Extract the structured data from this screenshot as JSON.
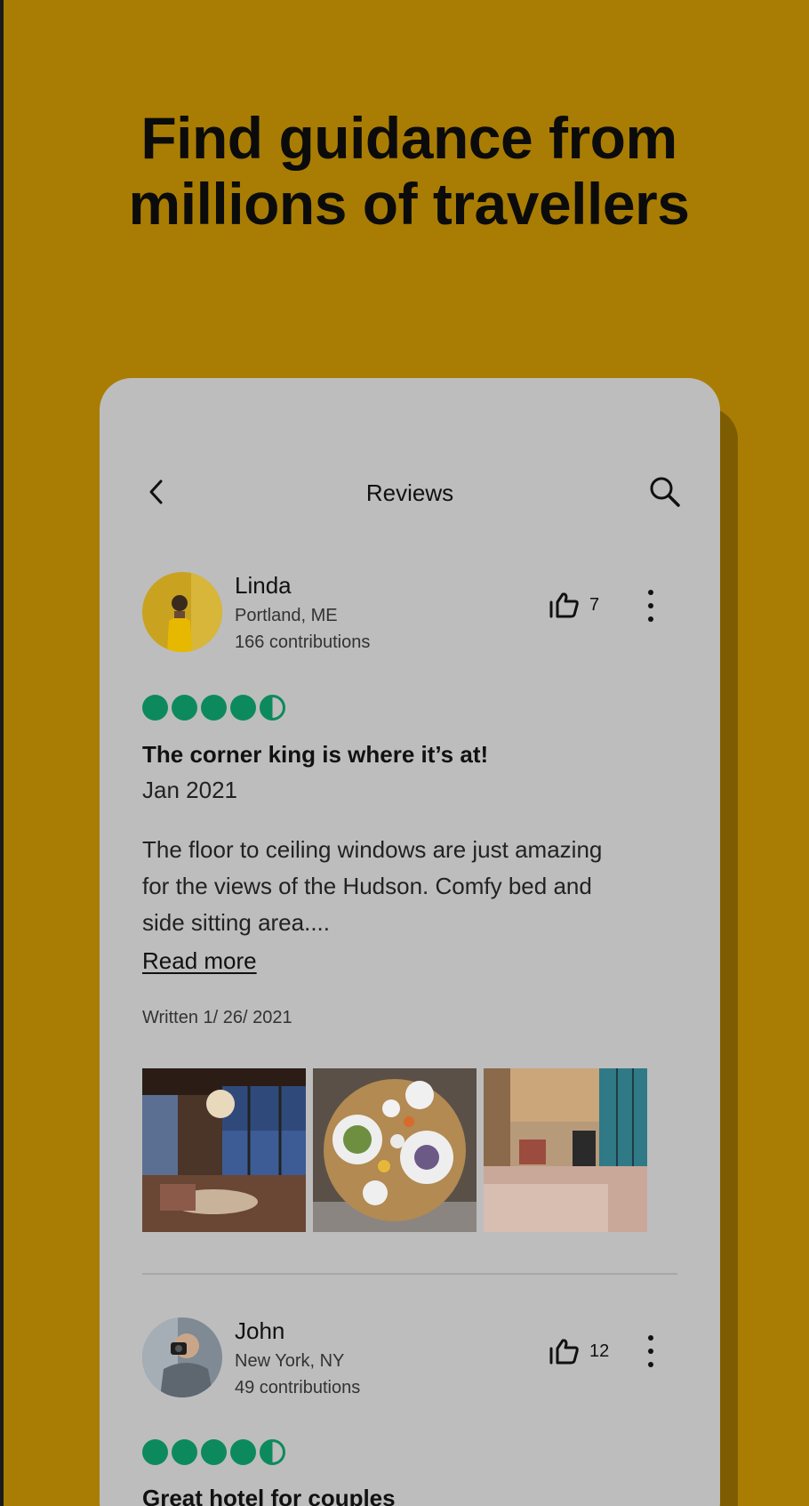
{
  "headline": {
    "line1": "Find guidance from",
    "line2": "millions of travellers"
  },
  "colors": {
    "background": "#A97D03",
    "card": "#BDBDBD",
    "rating_green": "#0C8A5D"
  },
  "topbar": {
    "back_icon": "chevron-left-icon",
    "title": "Reviews",
    "search_icon": "search-icon"
  },
  "reviews": [
    {
      "name": "Linda",
      "location": "Portland, ME",
      "contributions": "166 contributions",
      "likes": "7",
      "rating": 4.5,
      "title": "The corner king is where it’s at!",
      "date": "Jan 2021",
      "body_line1": "The floor to ceiling windows are just amazing",
      "body_line2": "for the views of the Hudson. Comfy bed and",
      "body_line3": "side sitting area....",
      "read_more": "Read more",
      "written": "Written 1/ 26/ 2021"
    },
    {
      "name": "John",
      "location": "New York, NY",
      "contributions": "49 contributions",
      "likes": "12",
      "rating": 4.5,
      "title": "Great hotel for couples"
    }
  ]
}
